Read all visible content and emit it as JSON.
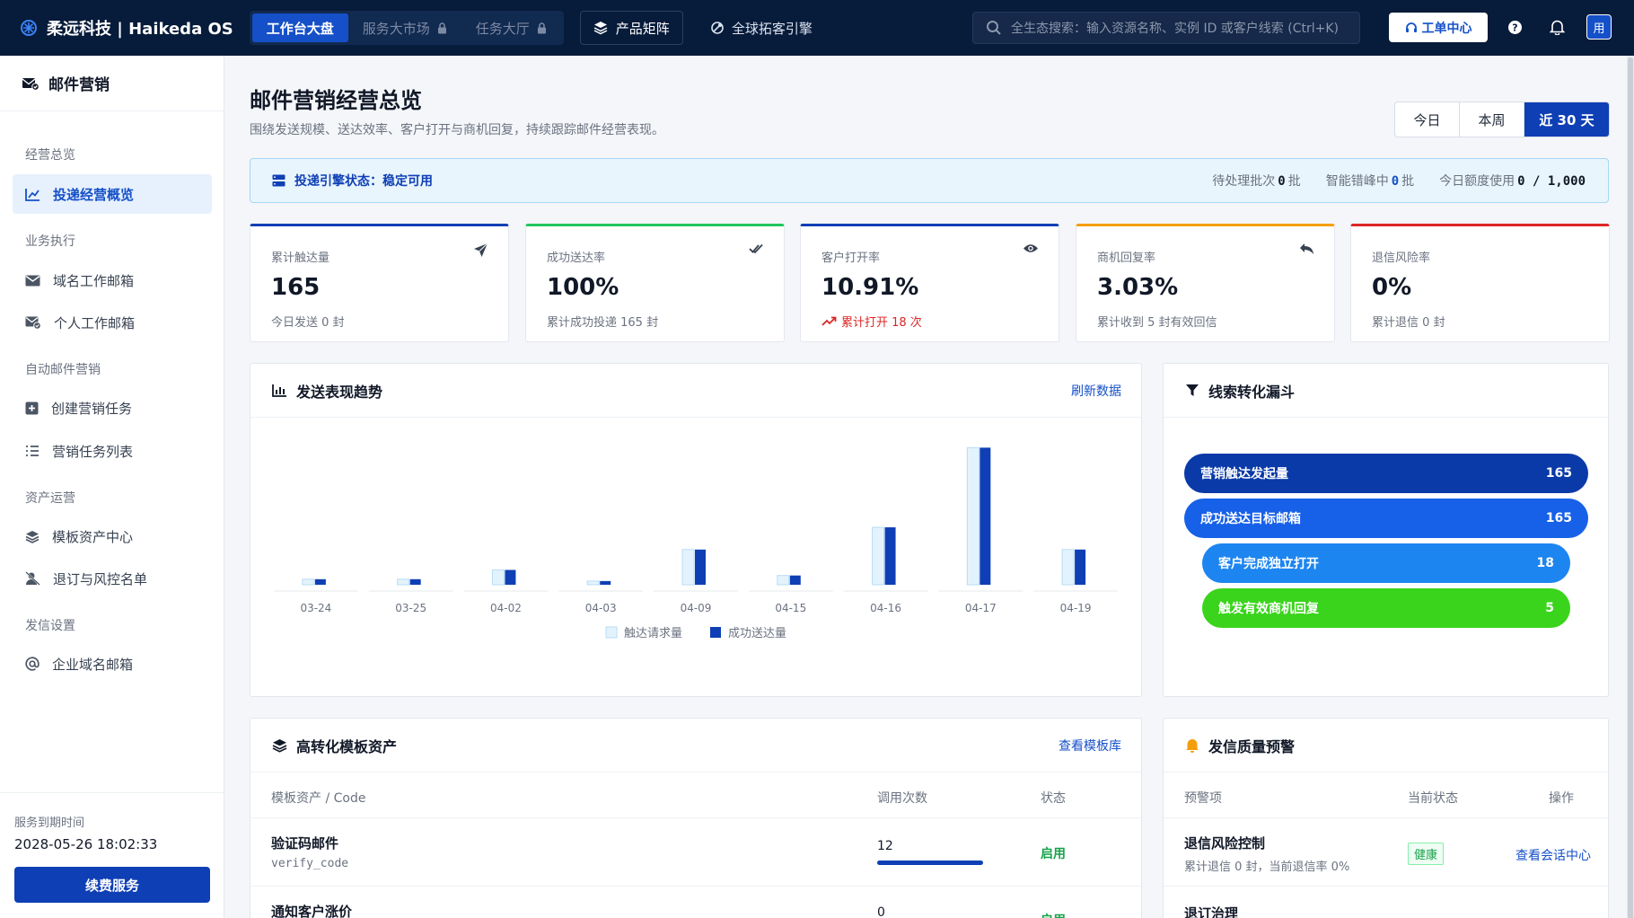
{
  "topbar": {
    "brand": "柔远科技 | Haikeda OS",
    "tabs": [
      {
        "label": "工作台大盘",
        "active": true
      },
      {
        "label": "服务大市场",
        "locked": true
      },
      {
        "label": "任务大厅",
        "locked": true
      }
    ],
    "product_matrix": "产品矩阵",
    "global_engine": "全球拓客引擎",
    "search_placeholder": "全生态搜索：输入资源名称、实例 ID 或客户线索 (Ctrl+K)",
    "ticket_center": "工单中心",
    "avatar": "用"
  },
  "sidebar": {
    "title": "邮件营销",
    "groups": [
      "经营总览",
      "业务执行",
      "自动邮件营销",
      "资产运营",
      "发信设置"
    ],
    "items": [
      {
        "label": "投递经营概览",
        "icon": "chart-line-icon",
        "active": true
      },
      {
        "label": "域名工作邮箱",
        "icon": "envelope-icon"
      },
      {
        "label": "个人工作邮箱",
        "icon": "envelope-check-icon"
      },
      {
        "label": "创建营销任务",
        "icon": "plus-square-icon"
      },
      {
        "label": "营销任务列表",
        "icon": "list-icon"
      },
      {
        "label": "模板资产中心",
        "icon": "layers-icon"
      },
      {
        "label": "退订与风控名单",
        "icon": "user-block-icon"
      },
      {
        "label": "企业域名邮箱",
        "icon": "at-icon"
      }
    ],
    "expire_label": "服务到期时间",
    "expire_value": "2028-05-26 18:02:33",
    "renew_button": "续费服务"
  },
  "header": {
    "title": "邮件营销经营总览",
    "subtitle": "围绕发送规模、送达效率、客户打开与商机回复，持续跟踪邮件经营表现。",
    "ranges": [
      {
        "label": "今日"
      },
      {
        "label": "本周"
      },
      {
        "label": "近 30 天",
        "active": true
      }
    ]
  },
  "status": {
    "label": "投递引擎状态：稳定可用",
    "pending_prefix": "待处理批次",
    "pending_value": "0",
    "pending_unit": "批",
    "peak_prefix": "智能错峰中",
    "peak_value": "0",
    "peak_unit": "批",
    "quota_prefix": "今日额度使用",
    "quota_value": "0 / 1,000"
  },
  "kpis": [
    {
      "label": "累计触达量",
      "value": "165",
      "sub": "今日发送 0 封",
      "icon": "paper-plane-icon",
      "color": "#0f3fb5"
    },
    {
      "label": "成功送达率",
      "value": "100%",
      "sub": "累计成功投递 165 封",
      "icon": "double-check-icon",
      "color": "#22c55e"
    },
    {
      "label": "客户打开率",
      "value": "10.91%",
      "sub": "累计打开 18 次",
      "icon": "eye-icon",
      "color": "#0f3fb5",
      "sub_red": true
    },
    {
      "label": "商机回复率",
      "value": "3.03%",
      "sub": "累计收到 5 封有效回信",
      "icon": "reply-icon",
      "color": "#f59e0b"
    },
    {
      "label": "退信风险率",
      "value": "0%",
      "sub": "累计退信 0 封",
      "icon": "",
      "color": "#dc2626"
    }
  ],
  "trend": {
    "title": "发送表现趋势",
    "refresh": "刷新数据"
  },
  "chart_data": {
    "type": "bar",
    "categories": [
      "03-24",
      "03-25",
      "04-02",
      "04-03",
      "04-09",
      "04-15",
      "04-16",
      "04-17",
      "04-19"
    ],
    "series": [
      {
        "name": "触达请求量",
        "values": [
          3,
          3,
          8,
          2,
          19,
          5,
          31,
          74,
          19
        ],
        "color": "#e3f3fd"
      },
      {
        "name": "成功送达量",
        "values": [
          3,
          3,
          8,
          2,
          19,
          5,
          31,
          74,
          19
        ],
        "color": "#0f3fb5"
      }
    ],
    "ylim": [
      0,
      80
    ]
  },
  "funnel": {
    "title": "线索转化漏斗",
    "stages": [
      {
        "label": "营销触达发起量",
        "value": "165",
        "color": "#0a3aa8"
      },
      {
        "label": "成功送达目标邮箱",
        "value": "165",
        "color": "#1760e8"
      },
      {
        "label": "客户完成独立打开",
        "value": "18",
        "color": "#1d85f0"
      },
      {
        "label": "触发有效商机回复",
        "value": "5",
        "color": "#3ad41c"
      }
    ]
  },
  "templates": {
    "title": "高转化模板资产",
    "link": "查看模板库",
    "columns": [
      "模板资产 / Code",
      "调用次数",
      "状态"
    ],
    "rows": [
      {
        "name": "验证码邮件",
        "code": "verify_code",
        "count": "12",
        "progress": 1.0,
        "status": "启用"
      },
      {
        "name": "通知客户涨价",
        "code": "",
        "count": "0",
        "progress": 0,
        "status": "启用"
      }
    ]
  },
  "alerts": {
    "title": "发信质量预警",
    "columns": [
      "预警项",
      "当前状态",
      "操作"
    ],
    "rows": [
      {
        "name": "退信风险控制",
        "desc": "累计退信 0 封，当前退信率 0%",
        "status": "健康",
        "action": "查看会话中心"
      },
      {
        "name": "退订治理",
        "desc": "",
        "status": "",
        "action": ""
      }
    ]
  }
}
